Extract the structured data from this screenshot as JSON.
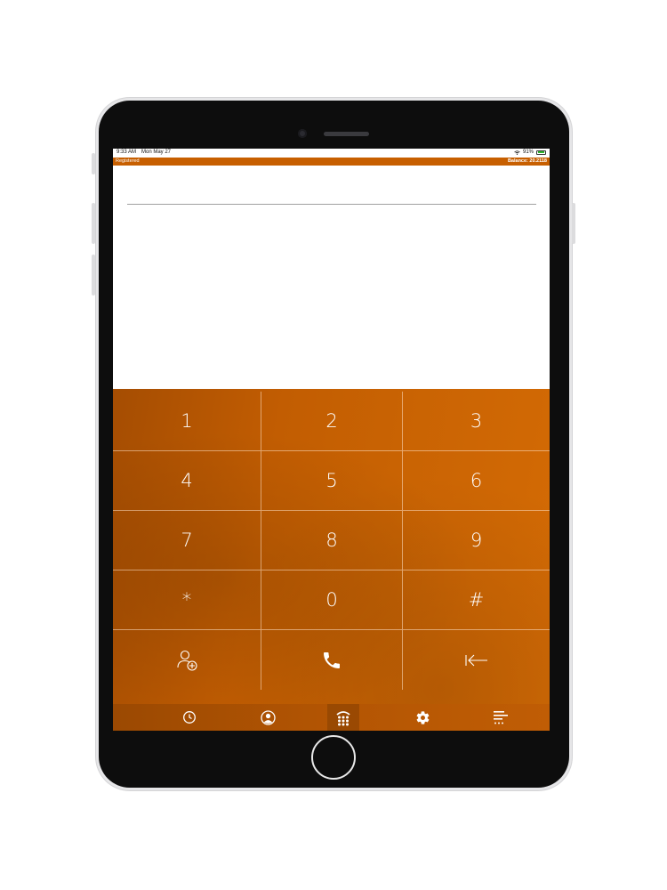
{
  "status_bar": {
    "time": "9:33 AM",
    "date": "Mon May 27",
    "battery": "91%",
    "battery_level": 0.91
  },
  "registration_bar": {
    "status": "Registered",
    "balance": "Balance: 20.2118"
  },
  "dialer": {
    "number_value": "",
    "keys": [
      "1",
      "2",
      "3",
      "4",
      "5",
      "6",
      "7",
      "8",
      "9",
      "*",
      "0",
      "#"
    ]
  },
  "actions": {
    "add_contact_icon": "add-contact-icon",
    "call_icon": "phone-icon",
    "backspace_icon": "backspace-icon"
  },
  "tab_bar": {
    "tabs": [
      {
        "icon": "clock-icon",
        "active": false
      },
      {
        "icon": "contact-icon",
        "active": false
      },
      {
        "icon": "dialpad-icon",
        "active": true
      },
      {
        "icon": "gear-icon",
        "active": false
      },
      {
        "icon": "menu-icon",
        "active": false
      }
    ]
  },
  "colors": {
    "accent": "#c75f00",
    "keypad": "#c96303",
    "key_text": "#ffffff"
  }
}
